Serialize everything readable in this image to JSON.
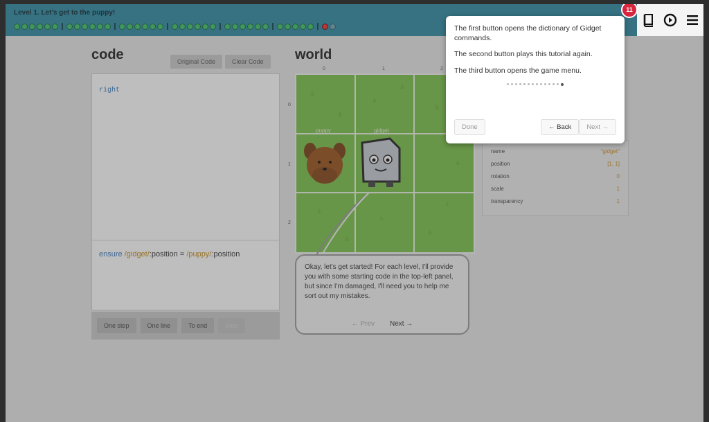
{
  "top_bar": {
    "level_title": "Level 1. Let's get to the puppy!",
    "notification_count": "11"
  },
  "code": {
    "heading": "code",
    "tabs": [
      "Original Code",
      "Clear Code"
    ],
    "program": "right",
    "goal": {
      "keyword": "ensure",
      "left_object": "/gidget/",
      "left_prop": ":position",
      "op": "=",
      "right_object": "/puppy/",
      "right_prop": ":position"
    },
    "controls": [
      "One step",
      "One line",
      "To end",
      "Stop"
    ]
  },
  "world": {
    "heading": "world",
    "x_ticks": [
      "0",
      "1",
      "2"
    ],
    "y_ticks": [
      "0",
      "1",
      "2"
    ],
    "labels": [
      "puppy",
      "gidget"
    ],
    "speech": "Okay, let's get started! For each level, I'll provide you with some starting code in the top-left panel, but since I'm damaged, I'll need you to help me sort out my mistakes.",
    "speech_prev": "← Prev",
    "speech_next": "Next →"
  },
  "properties": {
    "rows": [
      {
        "label": "name",
        "value": "\"gidget\""
      },
      {
        "label": "position",
        "value": "[1, 1]"
      },
      {
        "label": "rotation",
        "value": "0"
      },
      {
        "label": "scale",
        "value": "1"
      },
      {
        "label": "transparency",
        "value": "1"
      }
    ]
  },
  "tutorial_tooltip": {
    "p1": "The first button opens the dictionary of Gidget commands.",
    "p2": "The second button plays this tutorial again.",
    "p3": "The third button opens the game menu.",
    "done": "Done",
    "back": "← Back",
    "next": "Next →",
    "steps": 14,
    "active_step": 14
  },
  "colors": {
    "top_bar": "#2f8aa3",
    "grass": "#7cc24a",
    "gold": "#c58a15",
    "blue": "#3a78b8"
  }
}
